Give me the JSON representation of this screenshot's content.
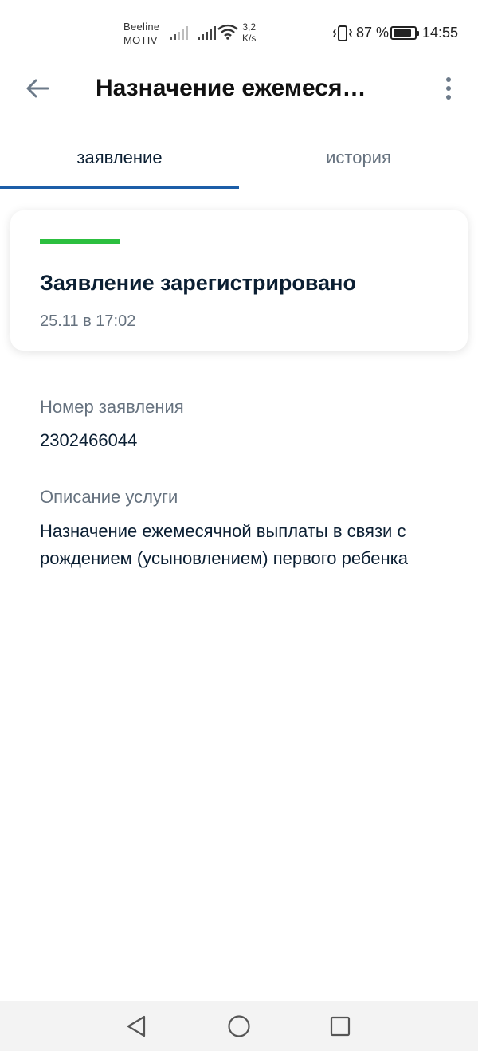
{
  "status_bar": {
    "carrier_top": "Beeline",
    "carrier_bottom": "MOTIV",
    "speed_value": "3,2",
    "speed_unit": "K/s",
    "battery_percent": "87 %",
    "battery_level": 0.87,
    "time": "14:55"
  },
  "app_bar": {
    "title": "Назначение ежемеся…",
    "back_icon": "arrow-left-icon",
    "more_icon": "more-vertical-icon"
  },
  "tabs": [
    {
      "label": "заявление",
      "active": true
    },
    {
      "label": "история",
      "active": false
    }
  ],
  "status_card": {
    "title": "Заявление зарегистрировано",
    "date": "25.11 в 17:02",
    "status_color": "#2cbf3f"
  },
  "details": {
    "number_label": "Номер заявления",
    "number_value": "2302466044",
    "description_label": "Описание услуги",
    "description_value": "Назначение ежемесячной выплаты в связи с рождением (усыновлением) первого ребенка"
  },
  "nav_bar": {
    "back_icon": "triangle-back-icon",
    "home_icon": "circle-home-icon",
    "recents_icon": "square-recents-icon"
  },
  "colors": {
    "accent": "#1c5ea8",
    "muted_text": "#66727f",
    "primary_text": "#0b1f33"
  }
}
